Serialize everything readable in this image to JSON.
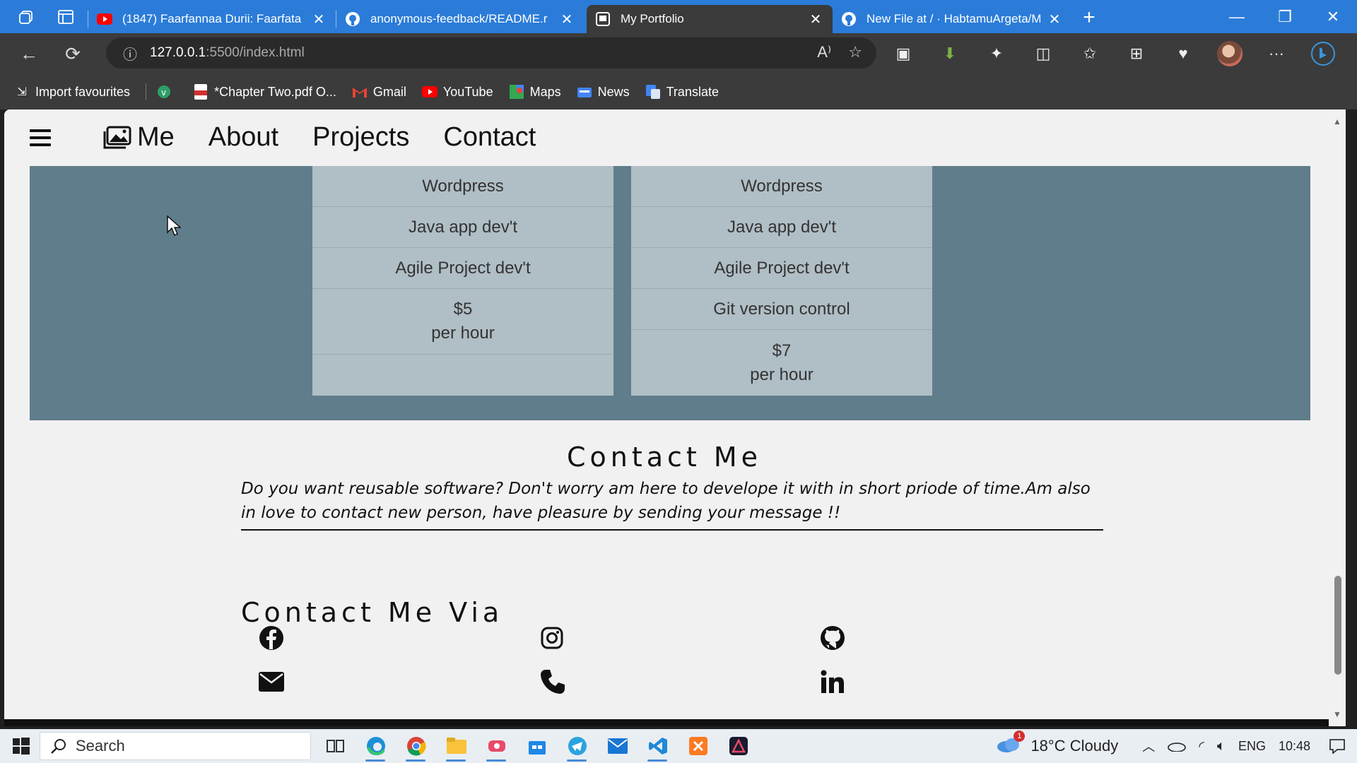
{
  "browser": {
    "tabs": [
      {
        "title": "(1847) Faarfannaa Durii: Faarfata",
        "favicon": "youtube-icon",
        "active": false
      },
      {
        "title": "anonymous-feedback/README.r",
        "favicon": "github-icon",
        "active": false
      },
      {
        "title": "My Portfolio",
        "favicon": "page-icon",
        "active": true
      },
      {
        "title": "New File at / · HabtamuArgeta/M",
        "favicon": "github-icon",
        "active": false
      }
    ],
    "url_host": "127.0.0.1",
    "url_path": ":5500/index.html",
    "bookmarks": [
      {
        "label": "Import favourites",
        "icon": "import-icon"
      },
      {
        "label": "",
        "icon": "vivaldi-icon"
      },
      {
        "label": "*Chapter Two.pdf O...",
        "icon": "pdf-icon"
      },
      {
        "label": "Gmail",
        "icon": "gmail-icon"
      },
      {
        "label": "YouTube",
        "icon": "youtube-icon"
      },
      {
        "label": "Maps",
        "icon": "maps-icon"
      },
      {
        "label": "News",
        "icon": "news-icon"
      },
      {
        "label": "Translate",
        "icon": "translate-icon"
      }
    ],
    "accent_color": "#2b7cd9"
  },
  "site": {
    "nav": {
      "brand": "Me",
      "links": [
        "About",
        "Projects",
        "Contact"
      ]
    },
    "pricing": {
      "bg_color": "#607d8b",
      "card_color": "#b0bec5",
      "cards": [
        {
          "rows": [
            "Wordpress",
            "Java app dev't",
            "Agile Project dev't"
          ],
          "price": "$5",
          "unit": "per hour"
        },
        {
          "rows": [
            "Wordpress",
            "Java app dev't",
            "Agile Project dev't",
            "Git version control"
          ],
          "price": "$7",
          "unit": "per hour"
        }
      ]
    },
    "contact": {
      "title": "Contact Me",
      "lead": "Do you want reusable software? Don't worry am here to develope it with in short priode of time.Am also in love to contact new person, have pleasure by sending your message !!",
      "via_title": "Contact Me Via",
      "socials": [
        "facebook-icon",
        "instagram-icon",
        "github-icon",
        "email-icon",
        "phone-icon",
        "linkedin-icon"
      ]
    }
  },
  "taskbar": {
    "search_placeholder": "Search",
    "weather": "18°C  Cloudy",
    "weather_badge": "1",
    "language": "ENG",
    "time": "10:48"
  }
}
